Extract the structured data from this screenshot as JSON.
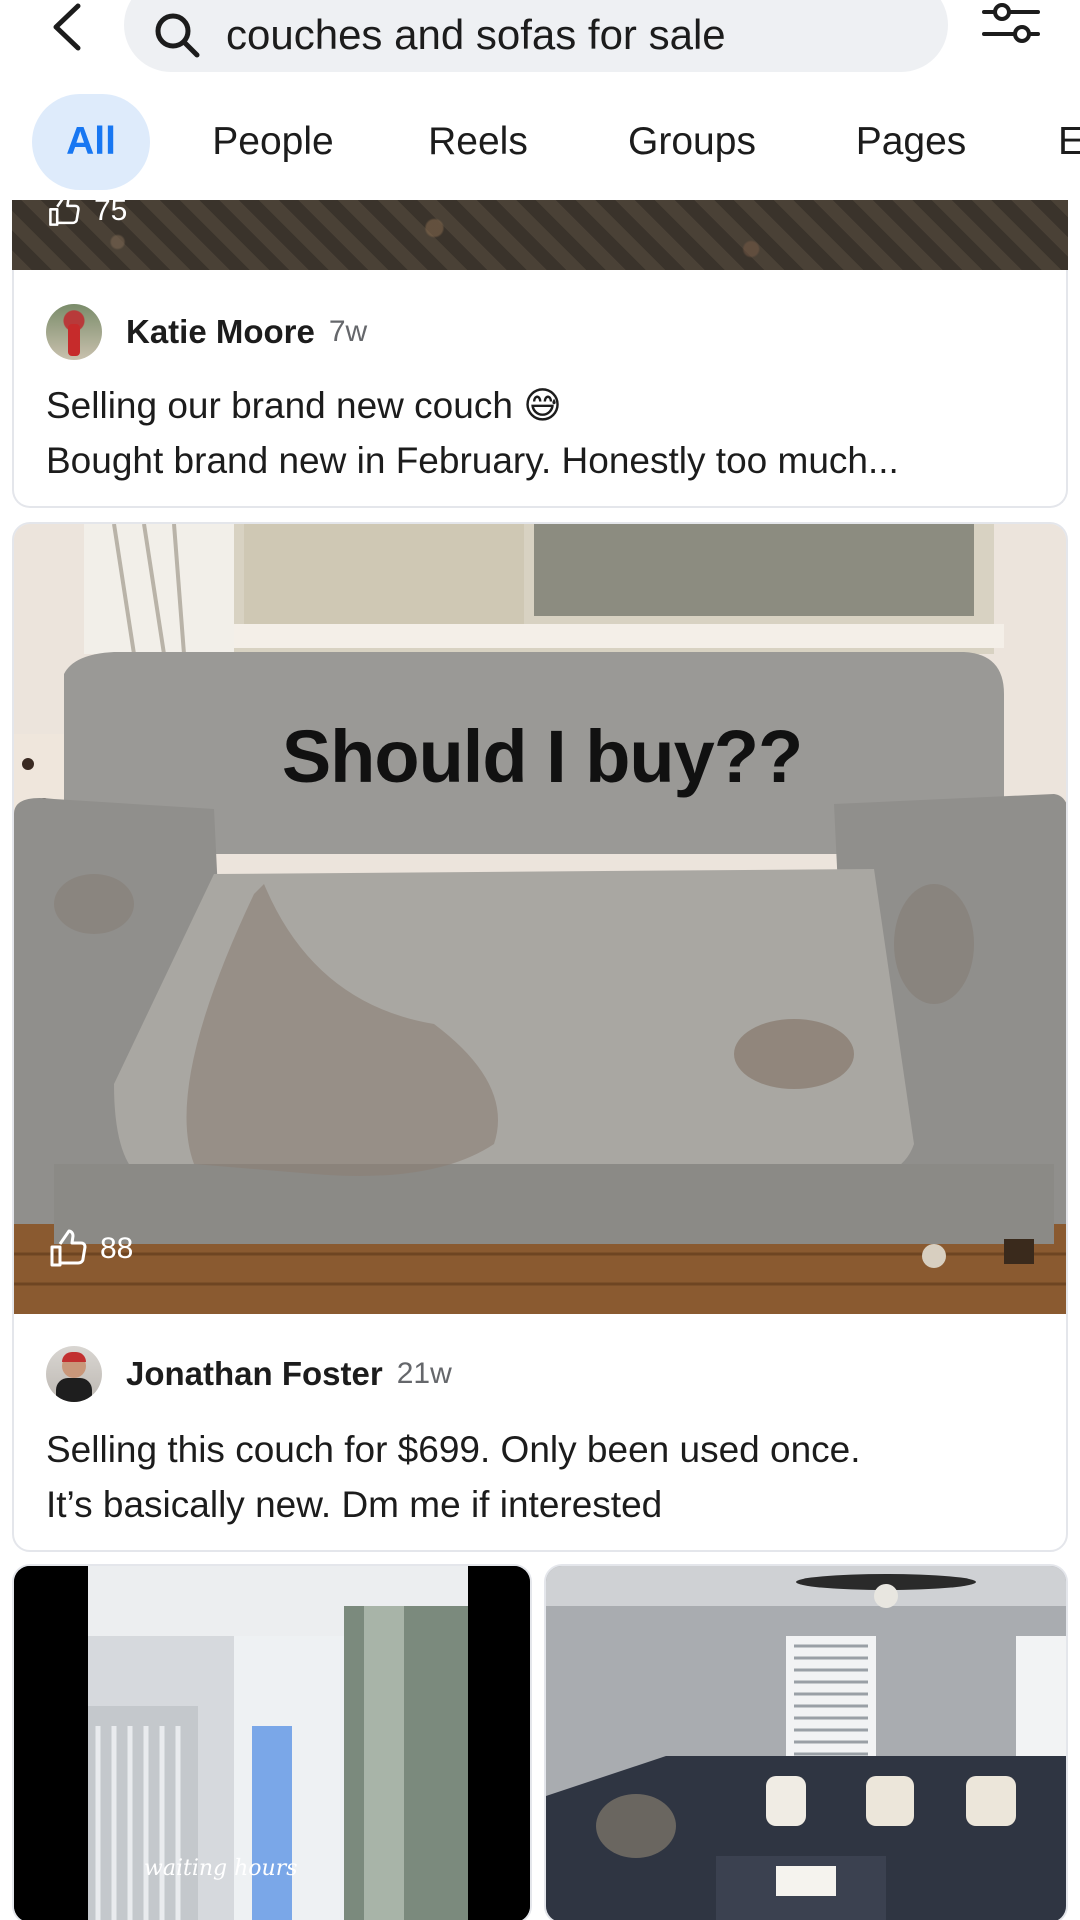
{
  "search": {
    "query": "couches and sofas for sale"
  },
  "tabs": [
    {
      "label": "All",
      "active": true
    },
    {
      "label": "People"
    },
    {
      "label": "Reels"
    },
    {
      "label": "Groups"
    },
    {
      "label": "Pages"
    },
    {
      "label": "E"
    }
  ],
  "posts": [
    {
      "author": "Katie Moore",
      "time": "7w",
      "text_line1": "Selling our brand new couch 😅",
      "text_line2": "Bought brand new in February. Honestly too much...",
      "top_like_count": "75"
    },
    {
      "author": "Jonathan Foster",
      "time": "21w",
      "image_caption": "Should I buy??",
      "like_count": "88",
      "text_line1": "Selling this couch for $699. Only been used once.",
      "text_line2": "It’s basically new. Dm me if interested"
    }
  ],
  "grid": {
    "left_caption": "waiting hours"
  },
  "colors": {
    "accent": "#1877f2",
    "active_tab_bg": "#deebfb",
    "search_bg": "#eef0f3"
  }
}
